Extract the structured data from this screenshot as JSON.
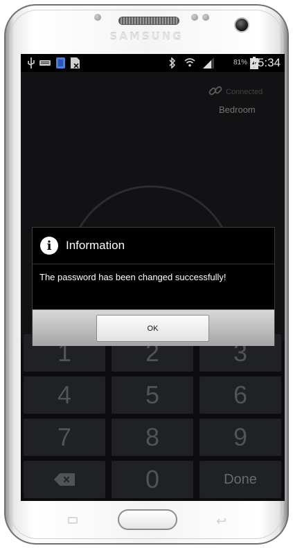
{
  "device": {
    "brand": "SAMSUNG"
  },
  "status_bar": {
    "icons_left": [
      "usb-icon",
      "keyboard-icon",
      "sim-icon",
      "file-icon"
    ],
    "icons_right": [
      "bluetooth-icon",
      "wifi-icon",
      "signal-icon",
      "battery-icon"
    ],
    "battery_percent": "81%",
    "time": "15:34"
  },
  "app": {
    "connection_status": "Connected",
    "room_name": "Bedroom",
    "keypad": {
      "keys": [
        "1",
        "2",
        "3",
        "4",
        "5",
        "6",
        "7",
        "8",
        "9",
        "backspace",
        "0",
        "Done"
      ]
    }
  },
  "dialog": {
    "title": "Information",
    "message": "The password has been changed successfully!",
    "ok_label": "OK"
  },
  "colors": {
    "screen_bg": "#18191c",
    "key_bg": "#2a2c30",
    "dialog_bg": "#000000",
    "button_bar": "#b5b5b5"
  }
}
